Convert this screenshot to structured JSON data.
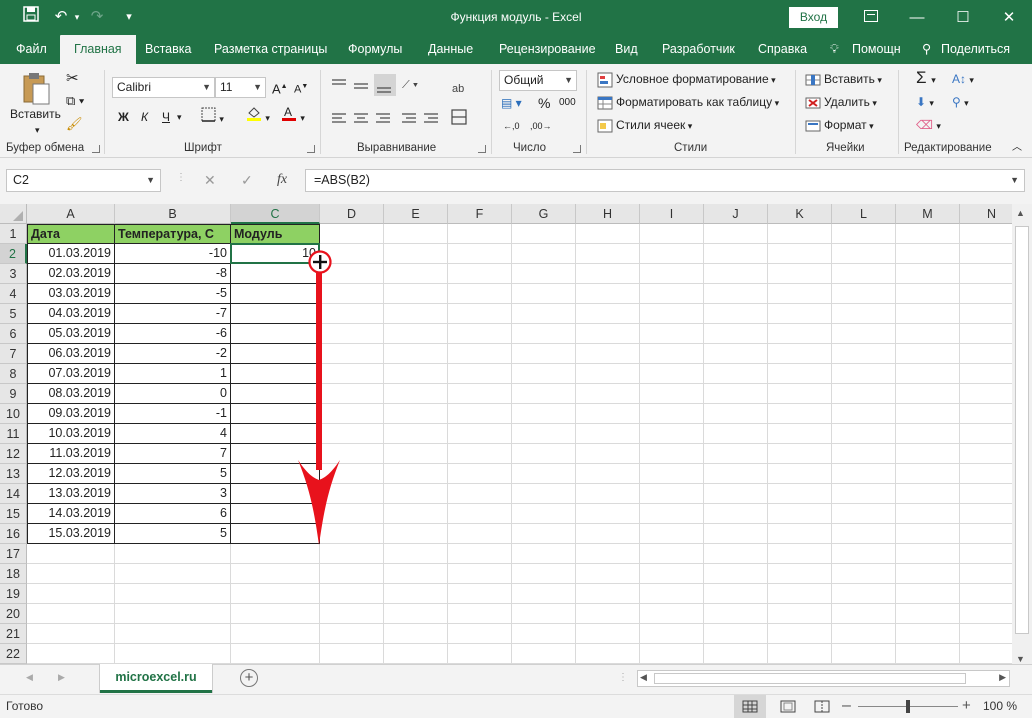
{
  "window": {
    "title": "Функция модуль  -  Excel",
    "login_label": "Вход",
    "minimize": "—",
    "restore": "☐",
    "close": "✕"
  },
  "tabs": [
    {
      "label": "Файл"
    },
    {
      "label": "Главная",
      "active": true
    },
    {
      "label": "Вставка"
    },
    {
      "label": "Разметка страницы"
    },
    {
      "label": "Формулы"
    },
    {
      "label": "Данные"
    },
    {
      "label": "Рецензирование"
    },
    {
      "label": "Вид"
    },
    {
      "label": "Разработчик"
    },
    {
      "label": "Справка"
    },
    {
      "label": "Помощн"
    },
    {
      "label": "Поделиться"
    }
  ],
  "ribbon": {
    "clipboard": {
      "paste_label": "Вставить",
      "group_label": "Буфер обмена"
    },
    "font": {
      "font_name": "Calibri",
      "font_size": "11",
      "bold": "Ж",
      "italic": "К",
      "underline": "Ч",
      "group_label": "Шрифт"
    },
    "alignment": {
      "group_label": "Выравнивание"
    },
    "number": {
      "format": "Общий",
      "percent": "%",
      "thousands": "000",
      "group_label": "Число"
    },
    "styles": {
      "conditional": "Условное форматирование",
      "as_table": "Форматировать как таблицу",
      "cell_styles": "Стили ячеек",
      "group_label": "Стили"
    },
    "cells": {
      "insert": "Вставить",
      "delete": "Удалить",
      "format": "Формат",
      "group_label": "Ячейки"
    },
    "editing": {
      "group_label": "Редактирование"
    }
  },
  "formula_bar": {
    "name_box": "C2",
    "formula": "=ABS(B2)",
    "fx": "fx"
  },
  "sheet": {
    "columns": [
      "A",
      "B",
      "C",
      "D",
      "E",
      "F",
      "G",
      "H",
      "I",
      "J",
      "K",
      "L",
      "M",
      "N"
    ],
    "rows": [
      "1",
      "2",
      "3",
      "4",
      "5",
      "6",
      "7",
      "8",
      "9",
      "10",
      "11",
      "12",
      "13",
      "14",
      "15",
      "16",
      "17",
      "18",
      "19",
      "20",
      "21",
      "22"
    ],
    "headers": [
      "Дата",
      "Температура, С",
      "Модуль"
    ],
    "data": [
      [
        "01.03.2019",
        "-10",
        "10"
      ],
      [
        "02.03.2019",
        "-8",
        ""
      ],
      [
        "03.03.2019",
        "-5",
        ""
      ],
      [
        "04.03.2019",
        "-7",
        ""
      ],
      [
        "05.03.2019",
        "-6",
        ""
      ],
      [
        "06.03.2019",
        "-2",
        ""
      ],
      [
        "07.03.2019",
        "1",
        ""
      ],
      [
        "08.03.2019",
        "0",
        ""
      ],
      [
        "09.03.2019",
        "-1",
        ""
      ],
      [
        "10.03.2019",
        "4",
        ""
      ],
      [
        "11.03.2019",
        "7",
        ""
      ],
      [
        "12.03.2019",
        "5",
        ""
      ],
      [
        "13.03.2019",
        "3",
        ""
      ],
      [
        "14.03.2019",
        "6",
        ""
      ],
      [
        "15.03.2019",
        "5",
        ""
      ]
    ],
    "selected_cell": "C2"
  },
  "sheet_tabs": [
    {
      "label": "microexcel.ru"
    }
  ],
  "status": {
    "ready": "Готово",
    "zoom": "100 %"
  },
  "colors": {
    "accent": "#217346",
    "header_fill": "#8ed163",
    "arrow": "#e8121c"
  }
}
